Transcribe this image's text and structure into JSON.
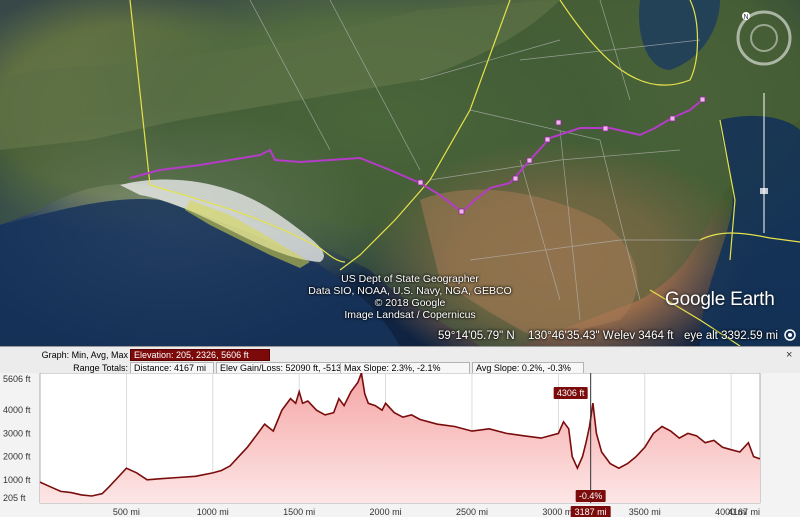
{
  "map": {
    "attribution": [
      "US Dept of State Geographer",
      "Data SIO, NOAA, U.S. Navy, NGA, GEBCO",
      "© 2018 Google",
      "Image Landsat / Copernicus"
    ],
    "logo": "Google Earth",
    "status": {
      "lat": "59°14'05.79\" N",
      "lon": "130°46'35.43\" W",
      "elev": "elev  3464 ft",
      "eye_alt": "eye alt 3392.59 mi"
    },
    "route_color": "#b43cc8",
    "border_color": "#e6e24a",
    "icons": [
      "north-arrow-icon",
      "look-joystick-icon",
      "move-joystick-icon",
      "zoom-slider",
      "street-view-icon"
    ]
  },
  "profile": {
    "graph_label": "Graph: Min, Avg, Max",
    "elevation_label": "Elevation: 205, 2326, 5606 ft",
    "range_totals_label": "Range Totals:",
    "distance_label": "Distance: 4167 mi",
    "elev_gain_loss_label": "Elev Gain/Loss: 52090 ft, -51331 ft",
    "max_slope_label": "Max Slope: 2.3%, -2.1%",
    "avg_slope_label": "Avg Slope: 0.2%, -0.3%",
    "close_label": "×"
  },
  "chart_data": {
    "type": "area",
    "title": "",
    "xlabel": "",
    "ylabel": "",
    "x_unit": "mi",
    "y_unit": "ft",
    "xlim": [
      0,
      4167
    ],
    "ylim": [
      0,
      5606
    ],
    "y_ticks": [
      "205 ft",
      "1000 ft",
      "2000 ft",
      "3000 ft",
      "4000 ft",
      "5606 ft"
    ],
    "y_tick_values": [
      205,
      1000,
      2000,
      3000,
      4000,
      5606
    ],
    "x_ticks": [
      "500 mi",
      "1000 mi",
      "1500 mi",
      "2000 mi",
      "2500 mi",
      "3000 mi",
      "3500 mi",
      "4000 mi",
      "4167 mi"
    ],
    "x_tick_values": [
      500,
      1000,
      1500,
      2000,
      2500,
      3000,
      3500,
      4000,
      4167
    ],
    "cursor": {
      "distance": 3187,
      "distance_label": "3187 mi",
      "elevation_label": "4306 ft",
      "slope_label": "-0.4%"
    },
    "series": [
      {
        "x": [
          0,
          60,
          120,
          180,
          240,
          300,
          360,
          400,
          450,
          500,
          560,
          620,
          700,
          800,
          900,
          1000,
          1050,
          1100,
          1150,
          1200,
          1250,
          1300,
          1350,
          1400,
          1450,
          1480,
          1500,
          1520,
          1550,
          1600,
          1650,
          1700,
          1730,
          1760,
          1800,
          1840,
          1860,
          1880,
          1900,
          1940,
          1980,
          2000,
          2050,
          2100,
          2150,
          2200,
          2300,
          2400,
          2500,
          2600,
          2700,
          2800,
          2900,
          3000,
          3030,
          3060,
          3080,
          3110,
          3140,
          3160,
          3180,
          3200,
          3220,
          3250,
          3300,
          3350,
          3400,
          3450,
          3500,
          3550,
          3600,
          3650,
          3700,
          3750,
          3800,
          3850,
          3900,
          3950,
          4000,
          4050,
          4100,
          4130,
          4167
        ],
        "y": [
          900,
          700,
          500,
          450,
          350,
          300,
          400,
          700,
          1100,
          1500,
          1300,
          1000,
          1050,
          1100,
          1150,
          1300,
          1400,
          1600,
          2000,
          2400,
          2900,
          3400,
          3100,
          4000,
          4500,
          4300,
          4800,
          4300,
          4400,
          4000,
          3800,
          3900,
          4500,
          4200,
          4800,
          5200,
          5606,
          4700,
          4300,
          4200,
          4000,
          4300,
          3900,
          3700,
          3800,
          3600,
          3400,
          3300,
          3100,
          3200,
          3000,
          2900,
          2800,
          3000,
          3500,
          3200,
          2000,
          1500,
          2000,
          2600,
          3300,
          4306,
          3000,
          2200,
          1700,
          1500,
          1700,
          2000,
          2400,
          3000,
          3300,
          3100,
          2800,
          3000,
          2900,
          2600,
          2700,
          2400,
          2300,
          2200,
          2600,
          2000,
          1900
        ]
      }
    ]
  }
}
